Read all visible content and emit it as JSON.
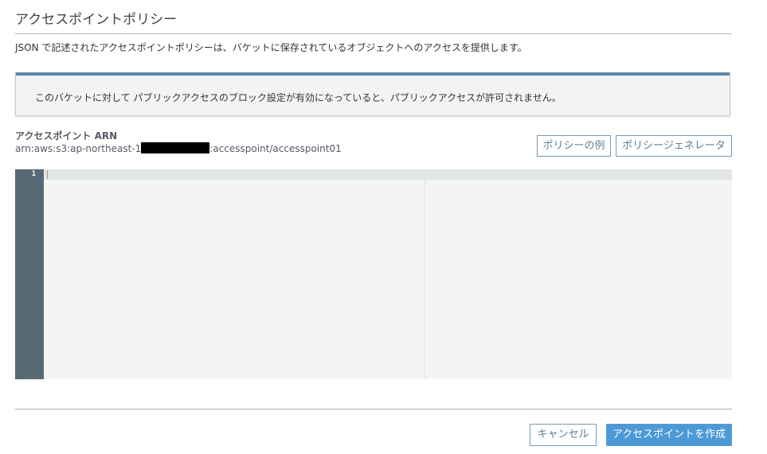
{
  "title": "アクセスポイントポリシー",
  "description": "JSON で記述されたアクセスポイントポリシーは、バケットに保存されているオブジェクトへのアクセスを提供します。",
  "info_message": "このバケットに対して パブリックアクセスのブロック設定が有効になっていると、パブリックアクセスが許可されません。",
  "arn": {
    "label": "アクセスポイント ARN",
    "prefix": "arn:aws:s3:ap-northeast-1",
    "suffix": ":accesspoint/accesspoint01"
  },
  "buttons": {
    "policy_example": "ポリシーの例",
    "policy_generator": "ポリシージェネレータ",
    "cancel": "キャンセル",
    "create": "アクセスポイントを作成"
  },
  "editor": {
    "line_numbers": [
      "1"
    ],
    "content": ""
  },
  "colors": {
    "accent": "#4b99d6",
    "info_border": "#5c87a6",
    "gutter": "#576974"
  }
}
